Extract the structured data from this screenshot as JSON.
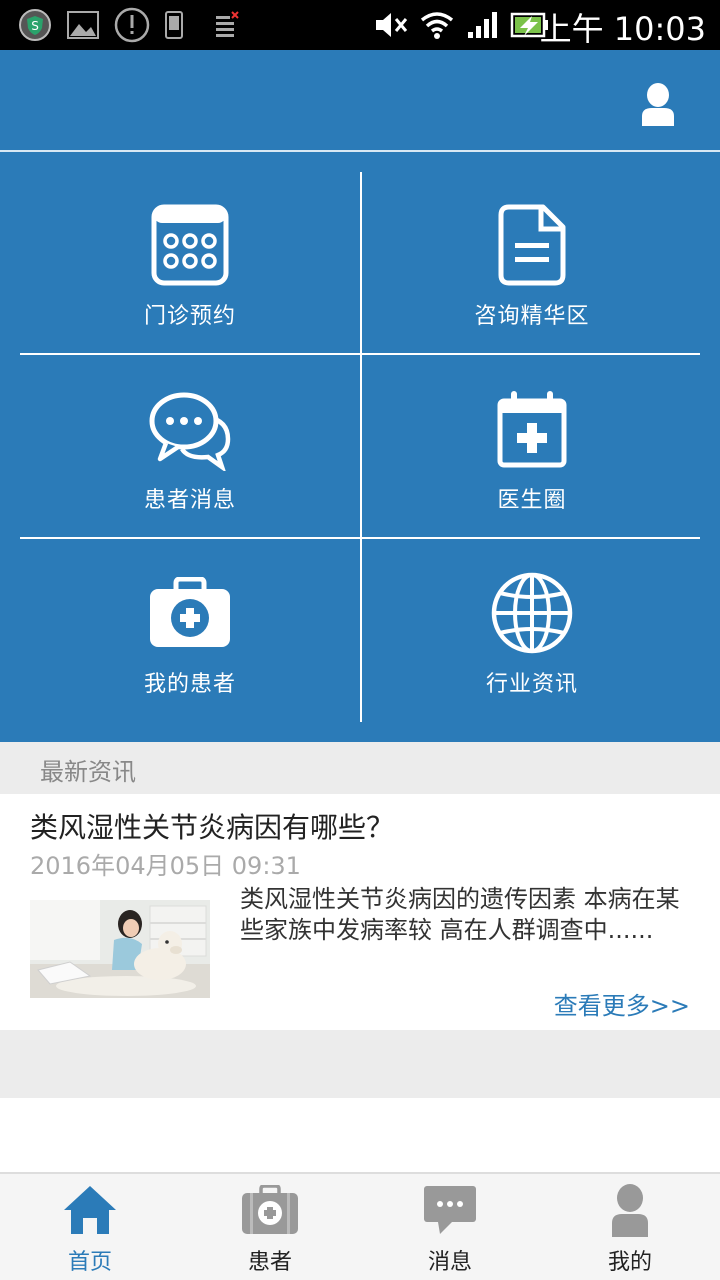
{
  "status_bar": {
    "time": "上午 10:03",
    "icons": [
      "shield-icon",
      "image-icon",
      "alert-icon",
      "phone-icon",
      "sim-icon",
      "mute-icon",
      "wifi-icon",
      "signal-icon",
      "battery-icon"
    ]
  },
  "header": {
    "user_icon": "user-icon",
    "accent": "#2b7bb8"
  },
  "menu": {
    "items": [
      {
        "label": "门诊预约",
        "icon": "calendar-grid-icon"
      },
      {
        "label": "咨询精华区",
        "icon": "document-icon"
      },
      {
        "label": "患者消息",
        "icon": "chat-bubbles-icon"
      },
      {
        "label": "医生圈",
        "icon": "medical-calendar-icon"
      },
      {
        "label": "我的患者",
        "icon": "medical-kit-icon"
      },
      {
        "label": "行业资讯",
        "icon": "globe-icon"
      }
    ]
  },
  "news": {
    "section_title": "最新资讯",
    "items": [
      {
        "title": "类风湿性关节炎病因有哪些？",
        "date": "2016年04月05日 09:31",
        "summary": "类风湿性关节炎病因的遗传因素 本病在某些家族中发病率较 高在人群调查中......",
        "more": "查看更多>>"
      }
    ]
  },
  "bottom_nav": {
    "items": [
      {
        "label": "首页",
        "icon": "home-icon",
        "active": true
      },
      {
        "label": "患者",
        "icon": "medical-kit-icon",
        "active": false
      },
      {
        "label": "消息",
        "icon": "chat-icon",
        "active": false
      },
      {
        "label": "我的",
        "icon": "user-icon",
        "active": false
      }
    ],
    "active_color": "#2b7bb8",
    "inactive_icon_color": "#999999"
  }
}
